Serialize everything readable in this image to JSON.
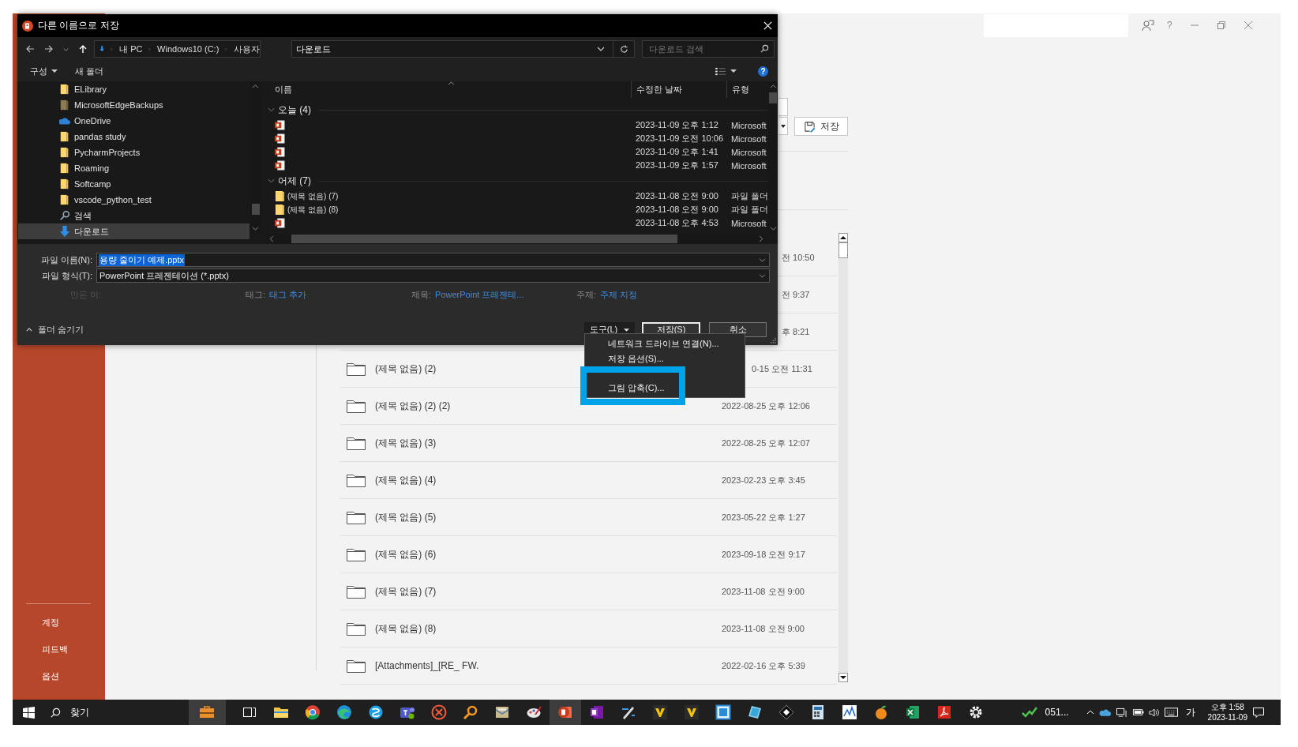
{
  "dialog": {
    "title": "다른 이름으로 저장",
    "breadcrumb": [
      "내 PC",
      "Windows10 (C:)",
      "사용자"
    ],
    "address": "다운로드",
    "search": {
      "placeholder": "다운로드 검색"
    },
    "toolbar": {
      "organize": "구성",
      "new_folder": "새 폴더",
      "help": "?"
    },
    "nav_items": [
      {
        "label": "ELibrary",
        "kind": "folder",
        "selected": false
      },
      {
        "label": "MicrosoftEdgeBackups",
        "kind": "folder_dim",
        "selected": false
      },
      {
        "label": "OneDrive",
        "kind": "cloud",
        "selected": false
      },
      {
        "label": "pandas study",
        "kind": "folder",
        "selected": false
      },
      {
        "label": "PycharmProjects",
        "kind": "folder",
        "selected": false
      },
      {
        "label": "Roaming",
        "kind": "folder",
        "selected": false
      },
      {
        "label": "Softcamp",
        "kind": "folder",
        "selected": false
      },
      {
        "label": "vscode_python_test",
        "kind": "folder",
        "selected": false
      },
      {
        "label": "검색",
        "kind": "search",
        "selected": false
      },
      {
        "label": "다운로드",
        "kind": "download",
        "selected": true
      }
    ],
    "columns": [
      "이름",
      "수정한 날짜",
      "유형"
    ],
    "groups": [
      {
        "label": "오늘 (4)",
        "expanded": true,
        "rows": [
          {
            "kind": "pptx",
            "date": "2023-11-09 오후 1:12",
            "type": "Microsoft"
          },
          {
            "kind": "pptx",
            "date": "2023-11-09 오전 10:06",
            "type": "Microsoft"
          },
          {
            "kind": "pptx",
            "date": "2023-11-09 오후 1:41",
            "type": "Microsoft"
          },
          {
            "kind": "pptx",
            "date": "2023-11-09 오후 1:57",
            "type": "Microsoft"
          }
        ]
      },
      {
        "label": "어제 (7)",
        "expanded": true,
        "rows": [
          {
            "kind": "folder",
            "name": "(제목 없음) (7)",
            "date": "2023-11-08 오전 9:00",
            "type": "파일 폴더"
          },
          {
            "kind": "folder",
            "name": "(제목 없음) (8)",
            "date": "2023-11-08 오전 9:00",
            "type": "파일 폴더"
          },
          {
            "kind": "pptx",
            "date": "2023-11-08 오후 4:53",
            "type": "Microsoft"
          }
        ]
      }
    ],
    "file_name": {
      "label": "파일 이름(N):",
      "value": "용량 줄이기 예제.pptx",
      "selected": true
    },
    "file_type": {
      "label": "파일 형식(T):",
      "value": "PowerPoint 프레젠테이션 (*.pptx)"
    },
    "meta": [
      {
        "label": "만든 이:"
      },
      {
        "label": "태그:",
        "value": "태그 추가"
      },
      {
        "label": "제목:",
        "value": "PowerPoint 프레젠테..."
      },
      {
        "label": "주제:",
        "value": "주제 지정"
      }
    ],
    "hide_folders": "폴더 숨기기",
    "buttons": [
      {
        "label": "도구(L)",
        "kind": "menu",
        "pressed": true
      },
      {
        "label": "저장(S)",
        "kind": "default",
        "pressed": false
      },
      {
        "label": "취소",
        "kind": "plain",
        "pressed": false
      }
    ]
  },
  "tools_menu": {
    "items": [
      {
        "kind": "item",
        "label": "네트워크 드라이브 연결(N)..."
      },
      {
        "kind": "item",
        "label": "저장 옵션(S)..."
      },
      {
        "kind": "covered"
      },
      {
        "kind": "item",
        "label": "그림 압축(C)..."
      }
    ]
  },
  "backstage": {
    "help": "?",
    "save_button": "저장",
    "sidebar_items": [
      "계정",
      "피드백",
      "옵션"
    ],
    "files": [
      {
        "kind": "covered_by_dialog",
        "date": "전 10:50"
      },
      {
        "kind": "covered_by_dialog",
        "date": "전 9:37"
      },
      {
        "kind": "covered_by_dialog",
        "date": "후 8:21"
      },
      {
        "kind": "date_covered",
        "name": "(제목 없음) (2)",
        "date": "0-15 오전 11:31"
      },
      {
        "kind": "folder",
        "name": "(제목 없음) (2) (2)",
        "date": "2022-08-25 오후 12:06"
      },
      {
        "kind": "folder",
        "name": "(제목 없음) (3)",
        "date": "2022-08-25 오후 12:07"
      },
      {
        "kind": "folder",
        "name": "(제목 없음) (4)",
        "date": "2023-02-23 오후 3:45"
      },
      {
        "kind": "folder",
        "name": "(제목 없음) (5)",
        "date": "2023-05-22 오후 1:27"
      },
      {
        "kind": "folder",
        "name": "(제목 없음) (6)",
        "date": "2023-09-18 오전 9:17"
      },
      {
        "kind": "folder",
        "name": "(제목 없음) (7)",
        "date": "2023-11-08 오전 9:00"
      },
      {
        "kind": "folder",
        "name": "(제목 없음) (8)",
        "date": "2023-11-08 오전 9:00"
      },
      {
        "kind": "folder",
        "name": "[Attachments]_[RE_ FW.",
        "date": "2022-02-16 오후 5:39"
      }
    ]
  },
  "taskbar": {
    "search_label": "찾기",
    "apps": [
      {
        "kind": "briefcase",
        "active": true
      },
      {
        "kind": "taskview",
        "active": false
      },
      {
        "kind": "folder",
        "active": false
      },
      {
        "kind": "circle",
        "active": false
      },
      {
        "kind": "wave",
        "active": false
      },
      {
        "kind": "bubble",
        "active": false
      },
      {
        "kind": "people",
        "active": false
      },
      {
        "kind": "cancel",
        "active": false
      },
      {
        "kind": "magnifier",
        "active": false
      },
      {
        "kind": "envelope",
        "active": false
      },
      {
        "kind": "palette",
        "active": false
      },
      {
        "kind": "slide",
        "active": true
      },
      {
        "kind": "notebook",
        "active": false
      },
      {
        "kind": "pen",
        "active": false
      },
      {
        "kind": "triangle",
        "active": false
      },
      {
        "kind": "triangle",
        "active": false
      },
      {
        "kind": "window",
        "active": false
      },
      {
        "kind": "tablet",
        "active": false
      },
      {
        "kind": "diamond",
        "active": false
      },
      {
        "kind": "calculator",
        "active": false
      },
      {
        "kind": "chart",
        "active": false
      },
      {
        "kind": "fruit",
        "active": false
      },
      {
        "kind": "spreadsheet",
        "active": false
      },
      {
        "kind": "document",
        "active": false
      },
      {
        "kind": "gear",
        "active": false
      }
    ],
    "tray_app_label": "051...",
    "ime": "가",
    "time": "오후 1:58",
    "date": "2023-11-09"
  }
}
